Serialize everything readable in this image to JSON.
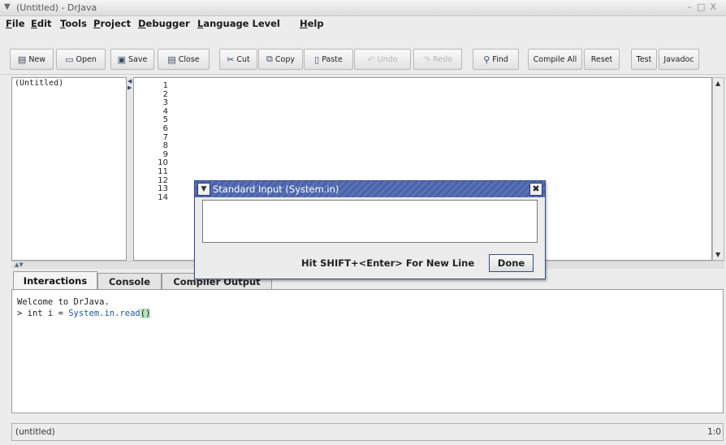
{
  "window": {
    "title": "(Untitled) - DrJava",
    "controls": [
      "–",
      "□",
      "X"
    ]
  },
  "menu": [
    "File",
    "Edit",
    "Tools",
    "Project",
    "Debugger",
    "Language Level",
    "Help"
  ],
  "toolbar": {
    "new": "New",
    "open": "Open",
    "save": "Save",
    "close": "Close",
    "cut": "Cut",
    "copy": "Copy",
    "paste": "Paste",
    "undo": "Undo",
    "redo": "Redo",
    "find": "Find",
    "compile_all": "Compile All",
    "reset": "Reset",
    "test": "Test",
    "javadoc": "Javadoc"
  },
  "documents": {
    "items": [
      "(Untitled)"
    ]
  },
  "editor": {
    "line_numbers": [
      "1",
      "2",
      "3",
      "4",
      "5",
      "6",
      "7",
      "8",
      "9",
      "10",
      "11",
      "12",
      "13",
      "14"
    ]
  },
  "tabs": [
    "Interactions",
    "Console",
    "Compiler Output"
  ],
  "interactions": {
    "line1": "Welcome to DrJava.",
    "prompt": ">",
    "line2_pre": " int i = ",
    "line2_call": "System.in.read",
    "line2_paren": "()"
  },
  "dialog": {
    "title": "Standard Input (System.in)",
    "input_value": "",
    "hint": "Hit SHIFT+<Enter> For New Line",
    "done_label": "Done"
  },
  "status": {
    "file": "(untitled)",
    "position": "1:0"
  },
  "colors": {
    "dialog_title": "#4a62a8",
    "keyword": "#1a5aa6",
    "paren_highlight": "#b7e3c2"
  }
}
